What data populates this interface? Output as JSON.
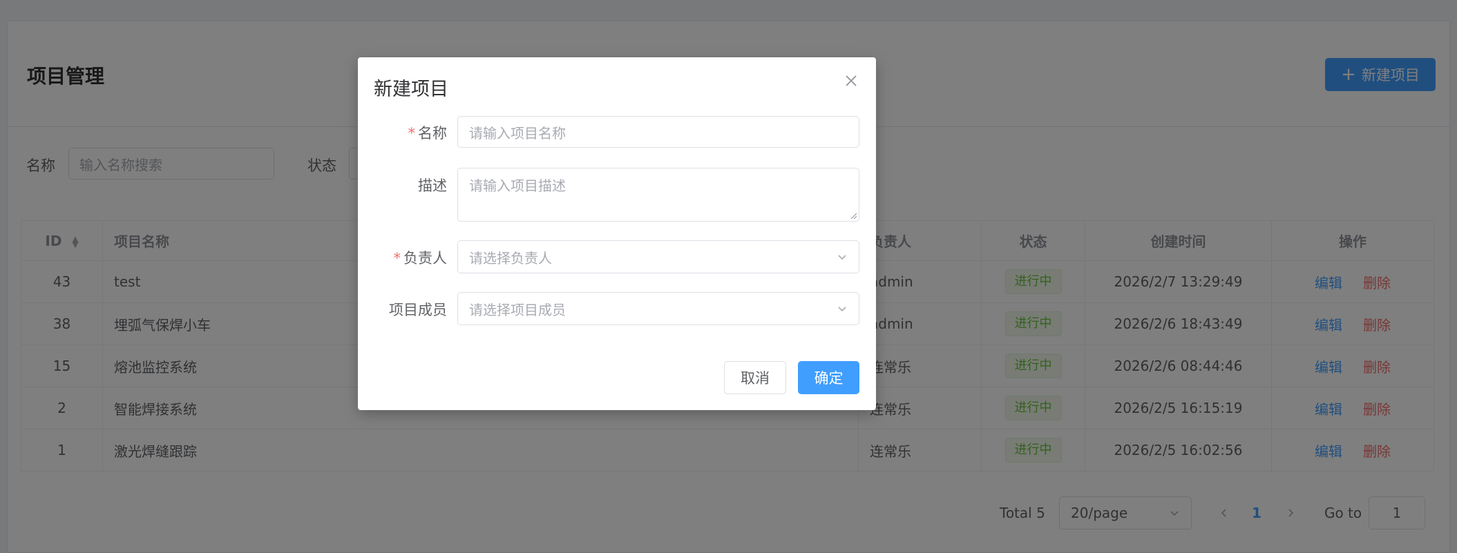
{
  "page": {
    "title": "项目管理",
    "new_button": "新建项目"
  },
  "filters": {
    "name_label": "名称",
    "name_placeholder": "输入名称搜索",
    "status_label": "状态"
  },
  "table": {
    "headers": [
      "ID",
      "项目名称",
      "负责人",
      "状态",
      "创建时间",
      "操作"
    ],
    "rows": [
      {
        "id": "43",
        "name": "test",
        "owner": "admin",
        "status": "进行中",
        "created": "2026/2/7 13:29:49"
      },
      {
        "id": "38",
        "name": "埋弧气保焊小车",
        "owner": "admin",
        "status": "进行中",
        "created": "2026/2/6 18:43:49"
      },
      {
        "id": "15",
        "name": "熔池监控系统",
        "owner": "连常乐",
        "status": "进行中",
        "created": "2026/2/6 08:44:46"
      },
      {
        "id": "2",
        "name": "智能焊接系统",
        "owner": "连常乐",
        "status": "进行中",
        "created": "2026/2/5 16:15:19"
      },
      {
        "id": "1",
        "name": "激光焊缝跟踪",
        "owner": "连常乐",
        "status": "进行中",
        "created": "2026/2/5 16:02:56"
      }
    ],
    "edit_label": "编辑",
    "delete_label": "删除"
  },
  "pagination": {
    "total": "Total 5",
    "page_size": "20/page",
    "current_page": "1",
    "goto_label": "Go to",
    "goto_value": "1"
  },
  "dialog": {
    "title": "新建项目",
    "name_label": "名称",
    "name_placeholder": "请输入项目名称",
    "desc_label": "描述",
    "desc_placeholder": "请输入项目描述",
    "owner_label": "负责人",
    "owner_placeholder": "请选择负责人",
    "members_label": "项目成员",
    "members_placeholder": "请选择项目成员",
    "cancel": "取消",
    "confirm": "确定"
  },
  "colors": {
    "primary": "#409eff",
    "danger": "#f56c6c",
    "success": "#67c23a"
  }
}
